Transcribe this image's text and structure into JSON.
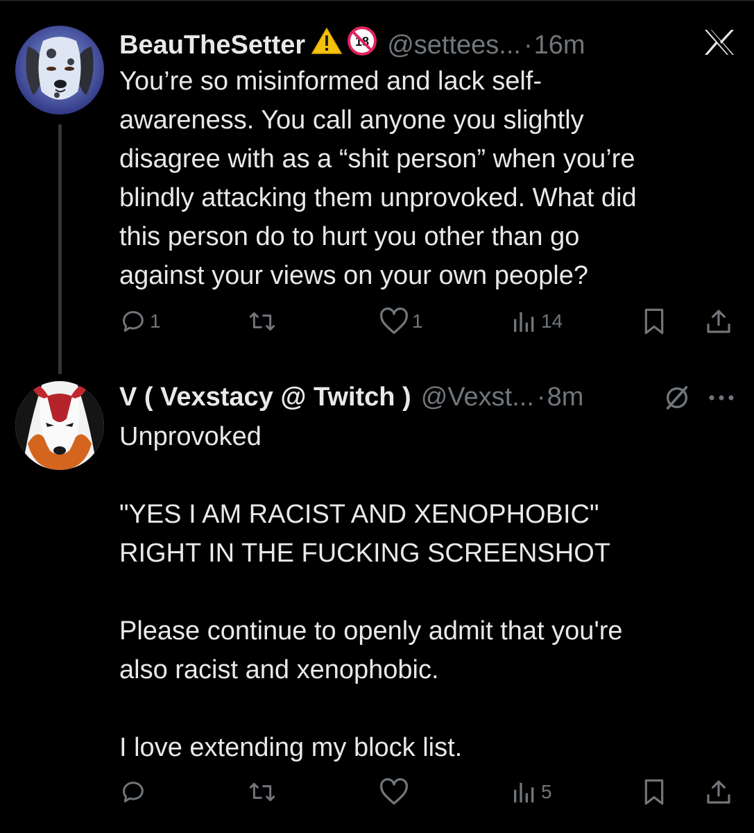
{
  "brand": {
    "logo_icon": "x-logo-icon"
  },
  "colors": {
    "background": "#000000",
    "text_primary": "#e7e9ea",
    "text_secondary": "#71767b",
    "thread_line": "#333639",
    "warning_yellow": "#f4c20d",
    "nsfw_red": "#e0245e"
  },
  "tweets": [
    {
      "display_name": "BeauTheSetter",
      "badges": [
        "warning-icon",
        "no-under-18-icon"
      ],
      "handle": "@settees...",
      "separator": "·",
      "time": "16m",
      "text": "You’re so misinformed and lack self-\nawareness. You call anyone you slightly\ndisagree with as a “shit person” when you’re\nblindly attacking them unprovoked. What did\nthis person do to hurt you other than go\nagainst your views on your own people?",
      "actions": {
        "replies": "1",
        "reposts": "",
        "likes": "1",
        "views": "14"
      }
    },
    {
      "display_name": "V ( Vexstacy @ Twitch )",
      "handle": "@Vexst...",
      "separator": "·",
      "time": "8m",
      "text": "Unprovoked\n\n\"YES I AM RACIST AND XENOPHOBIC\"\nRIGHT IN THE FUCKING SCREENSHOT\n\nPlease continue to openly admit that you're\nalso racist and xenophobic.\n\nI love extending my block list.",
      "actions": {
        "replies": "",
        "reposts": "",
        "likes": "",
        "views": "5"
      }
    }
  ]
}
